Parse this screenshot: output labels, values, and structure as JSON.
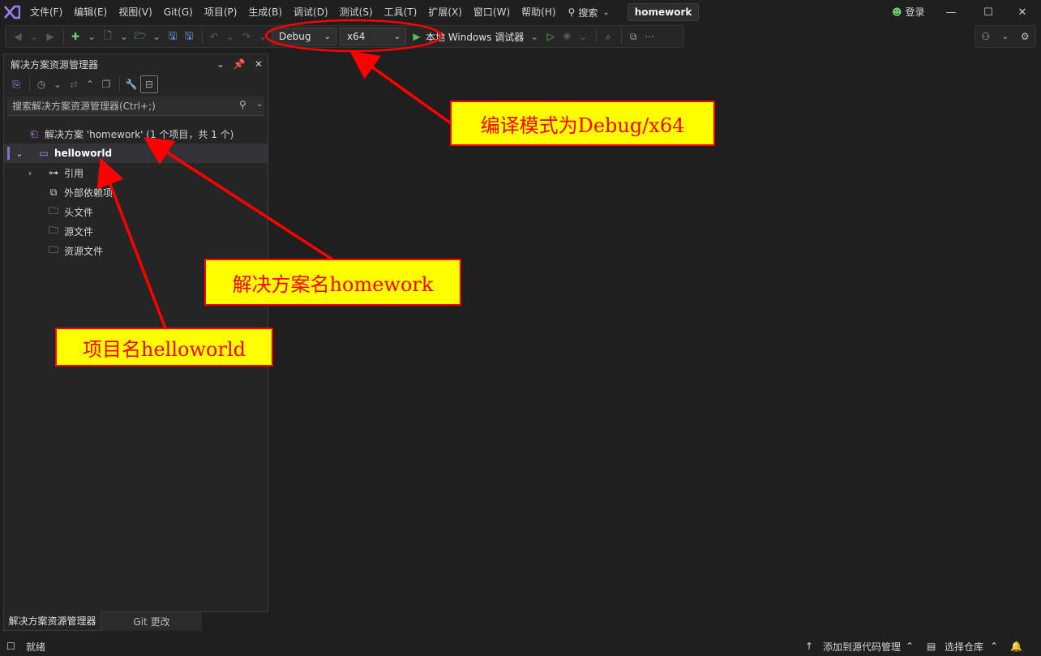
{
  "titlebar": {
    "menus": [
      "文件(F)",
      "编辑(E)",
      "视图(V)",
      "Git(G)",
      "项目(P)",
      "生成(B)",
      "调试(D)",
      "测试(S)",
      "工具(T)",
      "扩展(X)",
      "窗口(W)",
      "帮助(H)"
    ],
    "search_label": "搜索",
    "project_title": "homework",
    "login_label": "登录"
  },
  "toolbar": {
    "configuration": "Debug",
    "platform": "x64",
    "run_target": "本地 Windows 调试器"
  },
  "explorer": {
    "title": "解决方案资源管理器",
    "search_placeholder": "搜索解决方案资源管理器(Ctrl+;)",
    "solution_label": "解决方案 'homework' (1 个项目，共 1 个)",
    "project_label": "helloworld",
    "children": [
      "引用",
      "外部依赖项",
      "头文件",
      "源文件",
      "资源文件"
    ],
    "tabs": [
      "解决方案资源管理器",
      "Git 更改"
    ]
  },
  "statusbar": {
    "ready": "就绪",
    "add_source_control": "添加到源代码管理",
    "select_repo": "选择仓库"
  },
  "annotations": {
    "build_mode": "编译模式为Debug/x64",
    "solution_name": "解决方案名homework",
    "project_name": "项目名helloworld"
  },
  "colors": {
    "annotation_fill": "#ffff00",
    "annotation_red": "#ff0000",
    "vs_purple": "#8c6cdb",
    "run_green": "#5fb85f"
  }
}
